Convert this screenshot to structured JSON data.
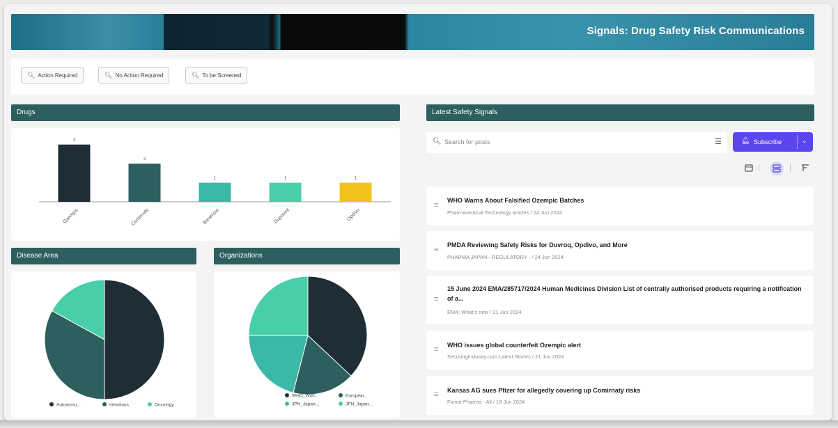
{
  "banner": {
    "title": "Signals: Drug Safety Risk Communications"
  },
  "filters": [
    {
      "label": "Action Required"
    },
    {
      "label": "No Action Required"
    },
    {
      "label": "To be Screened"
    }
  ],
  "sections": {
    "drugs": "Drugs",
    "disease_area": "Disease Area",
    "organizations": "Organizations",
    "latest": "Latest Safety Signals"
  },
  "search": {
    "placeholder": "Search for posts"
  },
  "subscribe": {
    "label": "Subscribe"
  },
  "colors": {
    "dark": "#1f2d37",
    "teal_dark": "#2c5f5d",
    "teal": "#3bb8a6",
    "teal_light": "#48cfaa",
    "yellow": "#f3c31b",
    "accent": "#5a46ec"
  },
  "chart_data": [
    {
      "type": "bar",
      "categories": [
        "Ozempic",
        "Comirnaty",
        "Bavencio",
        "Dupixent",
        "Opdivo"
      ],
      "values": [
        3,
        2,
        1,
        1,
        1
      ],
      "ylim": [
        0,
        3.5
      ],
      "colors": [
        "#1f2d37",
        "#2c5f5d",
        "#3bb8a6",
        "#48cfaa",
        "#f3c31b"
      ]
    },
    {
      "type": "pie",
      "labels": [
        "Autoimmu...",
        "Infectious",
        "Oncology"
      ],
      "values": [
        50,
        33,
        17
      ],
      "colors": [
        "#1f2d37",
        "#2c5f5d",
        "#48cfaa"
      ]
    },
    {
      "type": "pie",
      "labels": [
        "WHO_Worl...",
        "Europear...",
        "JPN_Japan...",
        "JPN_Japan..."
      ],
      "values": [
        37,
        17,
        21,
        25
      ],
      "colors": [
        "#1f2d37",
        "#2c5f5d",
        "#3bb8a6",
        "#48cfaa"
      ]
    }
  ],
  "posts": [
    {
      "title": "WHO Warns About Falsified Ozempic Batches",
      "meta": "Pharmaceutical Technology articles / 24 Jun 2024"
    },
    {
      "title": "PMDA Reviewing Safety Risks for Duvroq, Opdivo, and More",
      "meta": "PHARMA JAPAN - REGULATORY - / 24 Jun 2024"
    },
    {
      "title": "15 June 2024 EMA/285717/2024 Human Medicines Division List of centrally authorised products requiring a notification of a...",
      "meta": "EMA: What's new / 21 Jun 2024"
    },
    {
      "title": "WHO issues global counterfeit Ozempic alert",
      "meta": "SecuringIndustry.com Latest Stories / 21 Jun 2024"
    },
    {
      "title": "Kansas AG sues Pfizer for allegedly covering up Comirnaty risks",
      "meta": "Fierce Pharma - All / 18 Jun 2024"
    }
  ]
}
